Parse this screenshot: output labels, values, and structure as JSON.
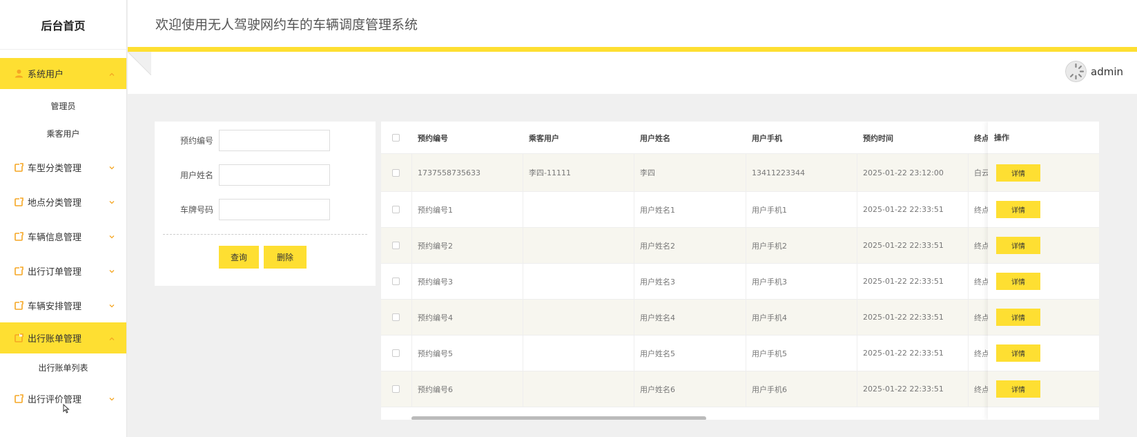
{
  "sidebar": {
    "brand": "后台首页",
    "menus": [
      {
        "label": "系统用户",
        "expanded": true,
        "icon": "user-icon",
        "subs": [
          "管理员",
          "乘客用户"
        ]
      },
      {
        "label": "车型分类管理",
        "expanded": false,
        "icon": "folder-icon",
        "subs": []
      },
      {
        "label": "地点分类管理",
        "expanded": false,
        "icon": "folder-icon",
        "subs": []
      },
      {
        "label": "车辆信息管理",
        "expanded": false,
        "icon": "folder-icon",
        "subs": []
      },
      {
        "label": "出行订单管理",
        "expanded": false,
        "icon": "folder-icon",
        "subs": []
      },
      {
        "label": "车辆安排管理",
        "expanded": false,
        "icon": "folder-icon",
        "subs": []
      },
      {
        "label": "出行账单管理",
        "expanded": true,
        "icon": "folder-icon",
        "subs": [
          "出行账单列表"
        ]
      },
      {
        "label": "出行评价管理",
        "expanded": false,
        "icon": "folder-icon",
        "subs": []
      }
    ]
  },
  "header": {
    "title": "欢迎使用无人驾驶网约车的车辆调度管理系统"
  },
  "user": {
    "name": "admin"
  },
  "search": {
    "fields": [
      {
        "label": "预约编号",
        "value": ""
      },
      {
        "label": "用户姓名",
        "value": ""
      },
      {
        "label": "车牌号码",
        "value": ""
      }
    ],
    "query_label": "查询",
    "delete_label": "删除"
  },
  "table": {
    "columns": [
      "预约编号",
      "乘客用户",
      "用户姓名",
      "用户手机",
      "预约时间",
      "终点"
    ],
    "op_header": "操作",
    "detail_label": "详情",
    "rows": [
      [
        "1737558735633",
        "李四-11111",
        "李四",
        "13411223344",
        "2025-01-22 23:12:00",
        "白云"
      ],
      [
        "预约编号1",
        "",
        "用户姓名1",
        "用户手机1",
        "2025-01-22 22:33:51",
        "终点"
      ],
      [
        "预约编号2",
        "",
        "用户姓名2",
        "用户手机2",
        "2025-01-22 22:33:51",
        "终点"
      ],
      [
        "预约编号3",
        "",
        "用户姓名3",
        "用户手机3",
        "2025-01-22 22:33:51",
        "终点"
      ],
      [
        "预约编号4",
        "",
        "用户姓名4",
        "用户手机4",
        "2025-01-22 22:33:51",
        "终点"
      ],
      [
        "预约编号5",
        "",
        "用户姓名5",
        "用户手机5",
        "2025-01-22 22:33:51",
        "终点"
      ],
      [
        "预约编号6",
        "",
        "用户姓名6",
        "用户手机6",
        "2025-01-22 22:33:51",
        "终点"
      ]
    ]
  },
  "colors": {
    "accent": "#fedf32",
    "icon": "#f5a623"
  }
}
